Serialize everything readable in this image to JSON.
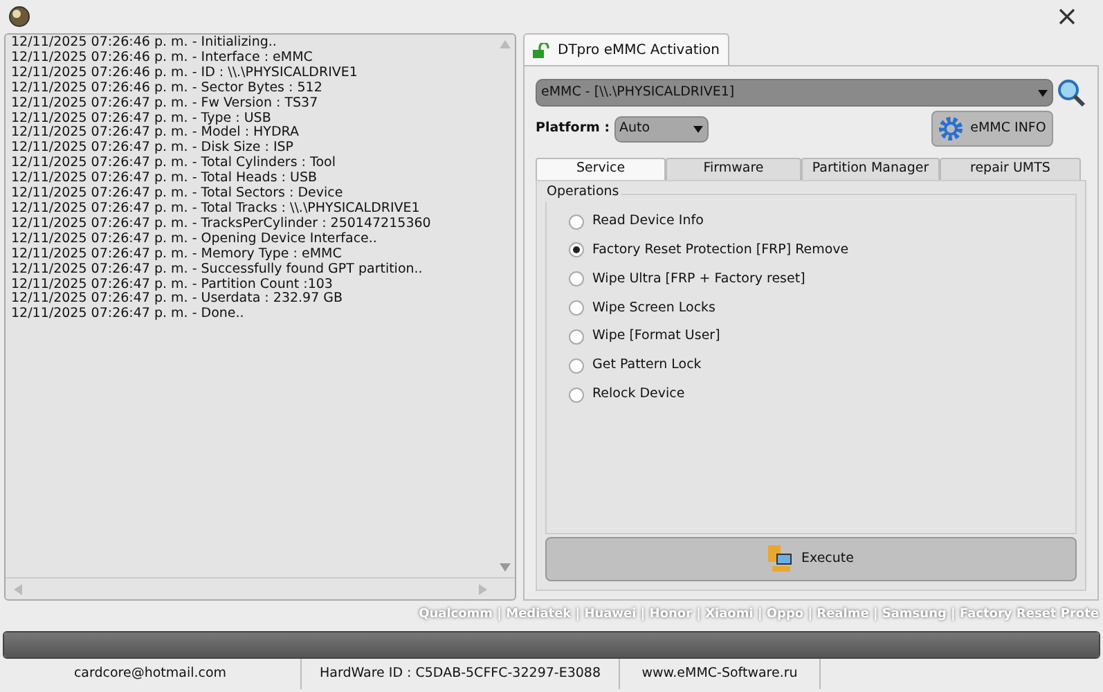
{
  "log": [
    "12/11/2025 07:26:46 p. m. - Initializing..",
    "12/11/2025 07:26:46 p. m. - Interface : eMMC",
    "12/11/2025 07:26:46 p. m. - ID : \\\\.\\PHYSICALDRIVE1",
    "12/11/2025 07:26:46 p. m. - Sector Bytes : 512",
    "12/11/2025 07:26:47 p. m. - Fw Version : TS37",
    "12/11/2025 07:26:47 p. m. - Type : USB",
    "12/11/2025 07:26:47 p. m. - Model : HYDRA",
    "12/11/2025 07:26:47 p. m. - Disk Size : ISP",
    "12/11/2025 07:26:47 p. m. - Total Cylinders : Tool",
    "12/11/2025 07:26:47 p. m. - Total Heads : USB",
    "12/11/2025 07:26:47 p. m. - Total Sectors : Device",
    "12/11/2025 07:26:47 p. m. - Total Tracks : \\\\.\\PHYSICALDRIVE1",
    "12/11/2025 07:26:47 p. m. - TracksPerCylinder : 250147215360",
    "12/11/2025 07:26:47 p. m. - Opening Device Interface..",
    "12/11/2025 07:26:47 p. m. - Memory Type : eMMC",
    "12/11/2025 07:26:47 p. m. - Successfully found GPT partition..",
    "12/11/2025 07:26:47 p. m. - Partition Count :103",
    "12/11/2025 07:26:47 p. m. - Userdata : 232.97 GB",
    "12/11/2025 07:26:47 p. m. - Done.."
  ],
  "main_tab": {
    "label": "DTpro eMMC Activation",
    "selected": true
  },
  "device_select": {
    "value": "eMMC - [\\\\.\\PHYSICALDRIVE1]"
  },
  "platform": {
    "label": "Platform :",
    "value": "Auto"
  },
  "info_button": "eMMC INFO",
  "tabs": [
    {
      "label": "Service",
      "selected": true
    },
    {
      "label": "Firmware",
      "selected": false
    },
    {
      "label": "Partition Manager",
      "selected": false
    },
    {
      "label": "repair UMTS",
      "selected": false
    }
  ],
  "operations": {
    "title": "Operations",
    "options": [
      {
        "label": "Read Device Info",
        "selected": false
      },
      {
        "label": "Factory Reset Protection [FRP] Remove",
        "selected": true
      },
      {
        "label": "Wipe Ultra [FRP + Factory reset]",
        "selected": false
      },
      {
        "label": "Wipe Screen Locks",
        "selected": false
      },
      {
        "label": "Wipe [Format User]",
        "selected": false
      },
      {
        "label": "Get Pattern Lock",
        "selected": false
      },
      {
        "label": "Relock Device",
        "selected": false
      }
    ]
  },
  "execute_button": "Execute",
  "brands": "Qualcomm | Mediatek | Huawei | Honor | Xiaomi | Oppo | Realme | Samsung | Factory Reset Prote",
  "progress": {
    "level": 1
  },
  "status_bar": [
    "cardcore@hotmail.com",
    "HardWare ID : C5DAB-5CFFC-32297-E3088",
    "www.eMMC-Software.ru"
  ]
}
